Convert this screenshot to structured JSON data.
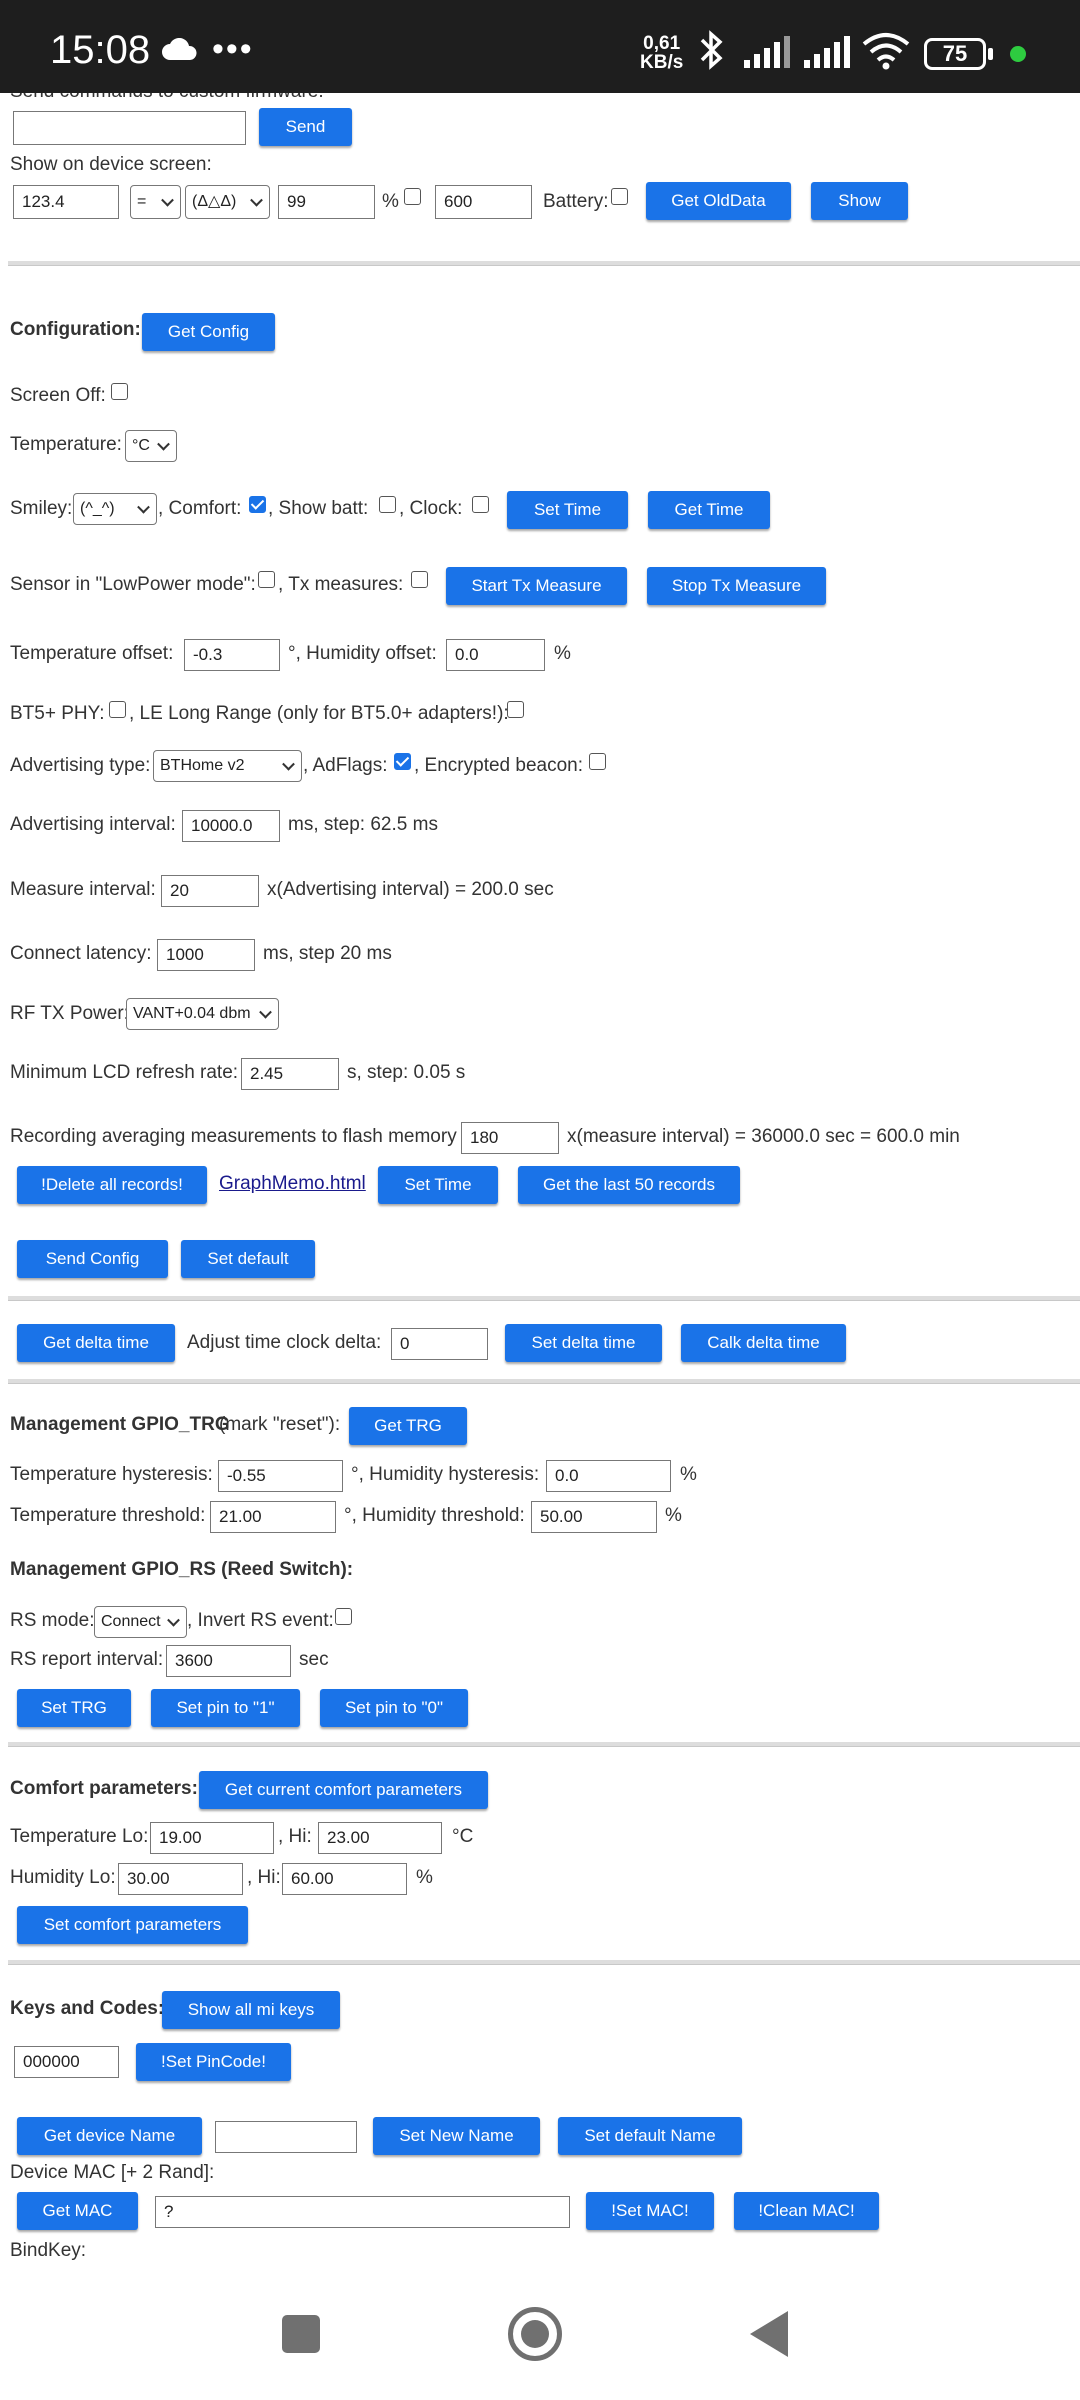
{
  "status_bar": {
    "time": "15:08",
    "dots": "•••",
    "speed_value": "0,61",
    "speed_unit": "KB/s",
    "battery": "75"
  },
  "top": {
    "send_commands_label": "Send commands to custom firmware:",
    "send_label": "Send",
    "show_on_screen_label": "Show on device screen:",
    "temp_value": "123.4",
    "operator_select": "=",
    "smiley_select": "(Δ△Δ)",
    "humidity_value": "99",
    "percent_label": "%",
    "time_value": "600",
    "battery_label": "Battery:",
    "get_olddata_label": "Get OldData",
    "show_label": "Show"
  },
  "config": {
    "title": "Configuration:",
    "get_config_label": "Get Config",
    "screen_off_label": "Screen Off:",
    "temperature_label": "Temperature:",
    "temperature_unit_select": "°C",
    "smiley_label": "Smiley:",
    "smiley_select": "(^_^)",
    "comfort_label": ", Comfort:",
    "show_batt_label": ", Show batt:",
    "clock_label": ", Clock:",
    "set_time_label": "Set Time",
    "get_time_label": "Get Time",
    "lowpower_label": "Sensor in \"LowPower mode\":",
    "tx_measures_label": ", Tx measures:",
    "start_tx_label": "Start Tx Measure",
    "stop_tx_label": "Stop Tx Measure",
    "temp_offset_label": "Temperature offset:",
    "temp_offset_value": "-0.3",
    "humidity_offset_label": "°, Humidity offset:",
    "humidity_offset_value": "0.0",
    "percent_label": "%",
    "bt5_label": "BT5+ PHY:",
    "long_range_label": ", LE Long Range (only for BT5.0+ adapters!):",
    "adv_type_label": "Advertising type:",
    "adv_type_select": "BTHome v2",
    "adflags_label": ", AdFlags:",
    "encrypted_label": ", Encrypted beacon:",
    "adv_interval_label": "Advertising interval:",
    "adv_interval_value": "10000.0",
    "adv_interval_unit": "ms, step: 62.5 ms",
    "measure_interval_label": "Measure interval:",
    "measure_interval_value": "20",
    "measure_interval_result": "x(Advertising interval) = 200.0 sec",
    "connect_latency_label": "Connect latency:",
    "connect_latency_value": "1000",
    "connect_latency_unit": "ms, step 20 ms",
    "rf_tx_power_label": "RF TX Power:",
    "rf_tx_power_select": "VANT+0.04 dbm",
    "lcd_refresh_label": "Minimum LCD refresh rate:",
    "lcd_refresh_value": "2.45",
    "lcd_refresh_unit": "s, step: 0.05 s",
    "recording_label": "Recording averaging measurements to flash memory",
    "recording_value": "180",
    "recording_result": "x(measure interval) = 36000.0 sec = 600.0 min",
    "delete_records_label": "!Delete all records!",
    "graph_link": "GraphMemo.html",
    "set_time2_label": "Set Time",
    "get_last_records_label": "Get the last 50 records",
    "send_config_label": "Send Config",
    "set_default_label": "Set default"
  },
  "delta": {
    "get_delta_label": "Get delta time",
    "adjust_label": "Adjust time clock delta:",
    "adjust_value": "0",
    "set_delta_label": "Set delta time",
    "calk_delta_label": "Calk delta time"
  },
  "trg": {
    "title": "Management GPIO_TRG",
    "subtitle": "(mark \"reset\"):",
    "get_trg_label": "Get TRG",
    "temp_hyst_label": "Temperature hysteresis:",
    "temp_hyst_value": "-0.55",
    "hum_hyst_label": "°, Humidity hysteresis:",
    "hum_hyst_value": "0.0",
    "temp_thr_label": "Temperature threshold:",
    "temp_thr_value": "21.00",
    "hum_thr_label": "°, Humidity threshold:",
    "hum_thr_value": "50.00",
    "percent_label": "%"
  },
  "rs": {
    "title": "Management GPIO_RS (Reed Switch):",
    "mode_label": "RS mode:",
    "mode_select": "Connect",
    "invert_label": ", Invert RS event:",
    "report_label": "RS report interval:",
    "report_value": "3600",
    "report_unit": "sec",
    "set_trg_label": "Set TRG",
    "set_pin1_label": "Set pin to \"1\"",
    "set_pin0_label": "Set pin to \"0\""
  },
  "comfort": {
    "title": "Comfort parameters:",
    "get_current_label": "Get current comfort parameters",
    "temp_lo_label": "Temperature Lo:",
    "temp_lo_value": "19.00",
    "hi_label": ", Hi:",
    "temp_hi_value": "23.00",
    "temp_unit": "°C",
    "hum_lo_label": "Humidity Lo:",
    "hum_lo_value": "30.00",
    "hum_hi_value": "60.00",
    "hum_unit": "%",
    "set_label": "Set comfort parameters"
  },
  "keys": {
    "title": "Keys and Codes:",
    "show_keys_label": "Show all mi keys",
    "pincode_value": "000000",
    "set_pincode_label": "!Set PinCode!",
    "get_name_label": "Get device Name",
    "name_value": "",
    "set_new_name_label": "Set New Name",
    "set_default_name_label": "Set default Name",
    "mac_label": "Device MAC [+ 2 Rand]:",
    "get_mac_label": "Get MAC",
    "mac_value": "?",
    "set_mac_label": "!Set MAC!",
    "clean_mac_label": "!Clean MAC!",
    "bindkey_label": "BindKey:"
  },
  "colors": {
    "accent": "#1a73e8",
    "statusbar": "#1e1e1e"
  }
}
